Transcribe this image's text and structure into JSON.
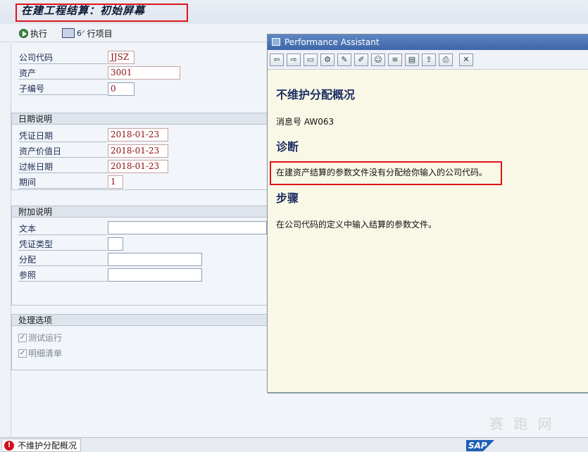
{
  "screen_title": "在建工程结算：初始屏幕",
  "toolbar": {
    "execute_label": "执行",
    "items_label": "行项目"
  },
  "company": {
    "company_code_label": "公司代码",
    "company_code_value": "JJSZ",
    "asset_label": "资产",
    "asset_value": "3001",
    "subnumber_label": "子编号",
    "subnumber_value": "0"
  },
  "dates": {
    "group_title": "日期说明",
    "doc_date_label": "凭证日期",
    "doc_date_value": "2018-01-23",
    "value_date_label": "资产价值日",
    "value_date_value": "2018-01-23",
    "posting_date_label": "过帐日期",
    "posting_date_value": "2018-01-23",
    "period_label": "期间",
    "period_value": "1"
  },
  "additional": {
    "group_title": "附加说明",
    "text_label": "文本",
    "doc_type_label": "凭证类型",
    "assignment_label": "分配",
    "reference_label": "参照"
  },
  "processing": {
    "group_title": "处理选项",
    "test_run_label": "测试运行",
    "detail_list_label": "明细清单"
  },
  "assistant": {
    "window_title": "Performance Assistant",
    "heading": "不维护分配概况",
    "message_no_label": "消息号",
    "message_no": "AW063",
    "diagnosis_title": "诊断",
    "diagnosis_text": "在建资产结算的参数文件没有分配给你输入的公司代码。",
    "procedure_title": "步骤",
    "procedure_text": "在公司代码的定义中输入结算的参数文件。"
  },
  "status_bar": {
    "message": "不维护分配概况"
  },
  "branding": {
    "logo_text": "SAP",
    "watermark_text": "赛 跑 网"
  },
  "colors": {
    "highlight_red": "#e0141b",
    "assistant_bg": "#f9f8e6",
    "title_blue": "#1e2e63"
  }
}
